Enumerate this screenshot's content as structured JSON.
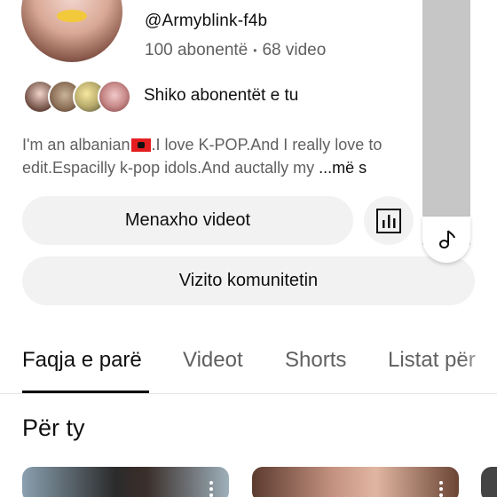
{
  "channel": {
    "handle": "@Armyblink-f4b",
    "subscribers": "100 abonentë",
    "separator": "•",
    "videos": "68 video",
    "subscribers_link": "Shiko abonentët e tu",
    "bio_line1_start": "I'm an albanian",
    "bio_line1_end": ".I love K-POP.And I really love to",
    "bio_line2": "edit.Espacilly k-pop idols.And auctally my",
    "bio_more": "...më s"
  },
  "buttons": {
    "manage_videos": "Menaxho videot",
    "visit_community": "Vizito komunitetin"
  },
  "tabs": [
    {
      "label": "Faqja e parë",
      "active": true
    },
    {
      "label": "Videot",
      "active": false
    },
    {
      "label": "Shorts",
      "active": false
    },
    {
      "label": "Listat për",
      "active": false
    }
  ],
  "section": {
    "title": "Për ty"
  },
  "icons": {
    "stats": "bar-chart-icon",
    "music": "music-note-icon",
    "more": "kebab-menu-icon"
  },
  "colors": {
    "text_primary": "#0f0f0f",
    "text_secondary": "#606060",
    "button_bg": "#f2f2f2",
    "flag_red": "#e41e20"
  }
}
